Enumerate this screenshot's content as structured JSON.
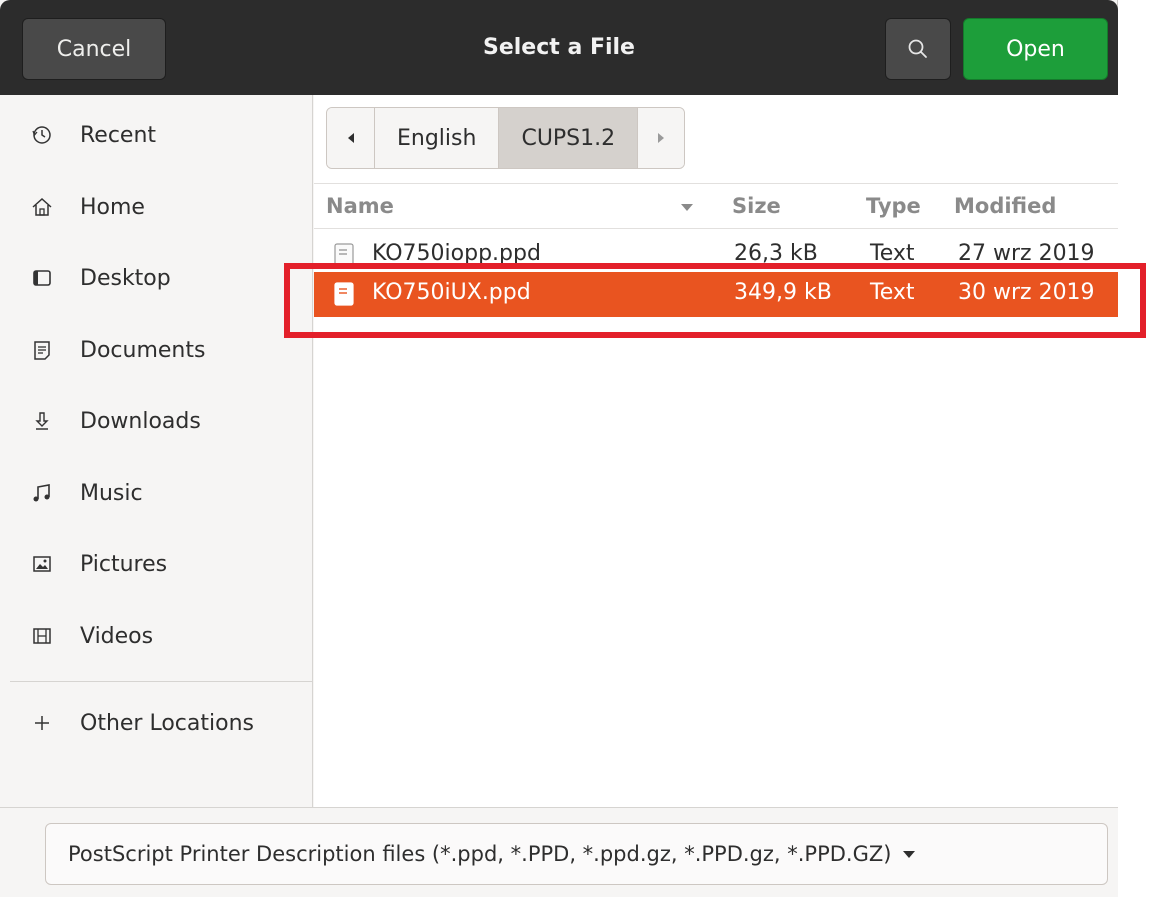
{
  "header": {
    "cancel_label": "Cancel",
    "title": "Select a File",
    "search_icon": "search-icon",
    "open_label": "Open"
  },
  "sidebar": {
    "items": [
      {
        "label": "Recent",
        "icon": "clock-icon"
      },
      {
        "label": "Home",
        "icon": "home-icon"
      },
      {
        "label": "Desktop",
        "icon": "desktop-icon"
      },
      {
        "label": "Documents",
        "icon": "documents-icon"
      },
      {
        "label": "Downloads",
        "icon": "download-icon"
      },
      {
        "label": "Music",
        "icon": "music-icon"
      },
      {
        "label": "Pictures",
        "icon": "pictures-icon"
      },
      {
        "label": "Videos",
        "icon": "videos-icon"
      }
    ],
    "other_locations": {
      "label": "Other Locations",
      "icon": "plus-icon"
    }
  },
  "pathbar": {
    "segments": [
      "English",
      "CUPS1.2"
    ],
    "active_index": 1
  },
  "columns": {
    "name": "Name",
    "size": "Size",
    "type": "Type",
    "modified": "Modified"
  },
  "files": [
    {
      "name": "KO750iopp.ppd",
      "size": "26,3 kB",
      "type": "Text",
      "modified": "27 wrz 2019",
      "selected": false
    },
    {
      "name": "KO750iUX.ppd",
      "size": "349,9 kB",
      "type": "Text",
      "modified": "30 wrz 2019",
      "selected": true
    }
  ],
  "filter": {
    "label": "PostScript Printer Description files (*.ppd, *.PPD, *.ppd.gz, *.PPD.gz, *.PPD.GZ)"
  },
  "colors": {
    "header_bg": "#2c2c2c",
    "open_button": "#1d9e3a",
    "selection": "#e95420",
    "highlight_box": "#e3202a"
  }
}
